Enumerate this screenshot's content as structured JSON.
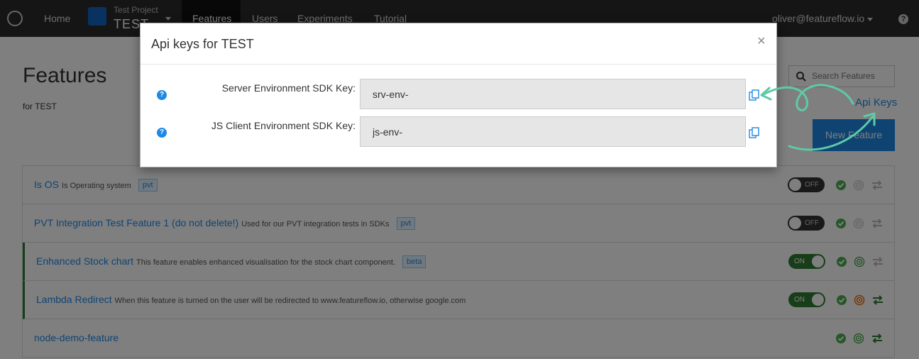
{
  "navbar": {
    "home": "Home",
    "project_label": "Test Project",
    "project_name": "TEST",
    "tabs": [
      "Features",
      "Users",
      "Experiments",
      "Tutorial"
    ],
    "user": "oliver@featureflow.io",
    "help": "?"
  },
  "page": {
    "title": "Features",
    "subtitle": "for TEST",
    "search_placeholder": "Search Features",
    "api_keys_link": "Api Keys",
    "new_feature_button": "New Feature"
  },
  "features": [
    {
      "name": "Is OS",
      "description": "Is Operating system",
      "tag": "pvt",
      "state": "OFF"
    },
    {
      "name": "PVT Integration Test Feature 1 (do not delete!)",
      "description": "Used for our PVT integration tests in SDKs",
      "tag": "pvt",
      "state": "OFF"
    },
    {
      "name": "Enhanced Stock chart",
      "description": "This feature enables enhanced visualisation for the stock chart component.",
      "tag": "beta",
      "state": "ON"
    },
    {
      "name": "Lambda Redirect",
      "description": "When this feature is turned on the user will be redirected to www.featureflow.io, otherwise google.com",
      "tag": "",
      "state": "ON"
    },
    {
      "name": "node-demo-feature",
      "description": "",
      "tag": "",
      "state": ""
    }
  ],
  "modal": {
    "title": "Api keys for TEST",
    "close": "×",
    "server_label": "Server Environment SDK Key:",
    "server_value": "srv-env-",
    "js_label": "JS Client Environment SDK Key:",
    "js_value": "js-env-",
    "help": "?"
  },
  "colors": {
    "accent": "#1e88e5",
    "navbar": "#2b2b2b",
    "on_green": "#2e7d32",
    "arrow": "#5fc9a8"
  }
}
